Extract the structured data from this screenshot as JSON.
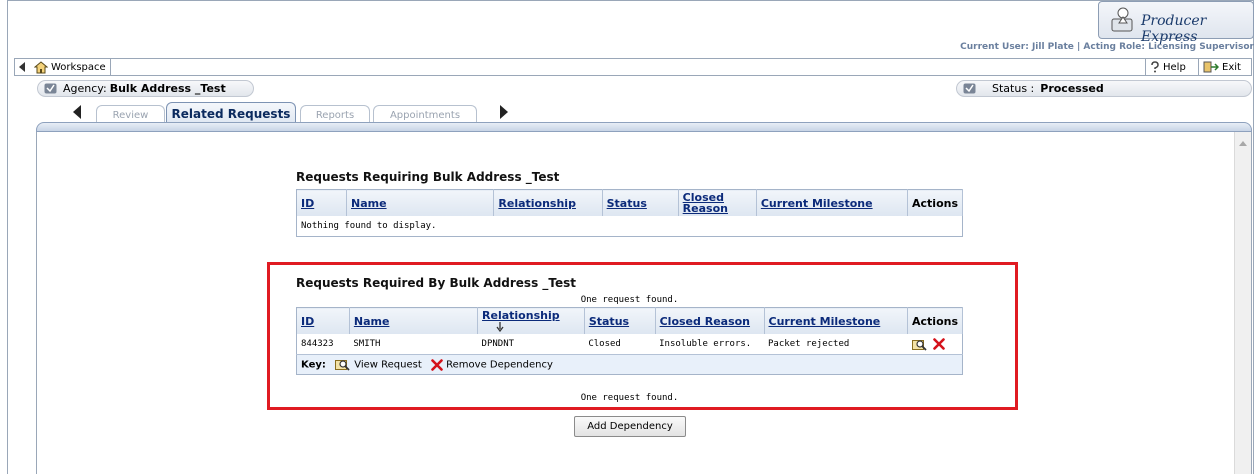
{
  "brand": {
    "name": "Producer Express"
  },
  "header": {
    "current_user_line": "Current User: Jill Plate | Acting Role: Licensing Supervisor"
  },
  "toolbar": {
    "workspace_label": "Workspace",
    "help_label": "Help",
    "exit_label": "Exit"
  },
  "agency": {
    "label": "Agency:",
    "name": "Bulk Address _Test"
  },
  "status": {
    "label": "Status :",
    "value": "Processed"
  },
  "tabs": [
    {
      "label": "Review",
      "active": false
    },
    {
      "label": "Related Requests",
      "active": true
    },
    {
      "label": "Reports",
      "active": false
    },
    {
      "label": "Appointments",
      "active": false
    }
  ],
  "requiring": {
    "title": "Requests Requiring Bulk Address _Test",
    "columns": [
      "ID",
      "Name",
      "Relationship",
      "Status",
      "Closed Reason",
      "Current Milestone",
      "Actions"
    ],
    "empty_message": "Nothing found to display."
  },
  "required_by": {
    "title": "Requests Required By Bulk Address _Test",
    "count_message": "One request found.",
    "columns": [
      "ID",
      "Name",
      "Relationship",
      "Status",
      "Closed Reason",
      "Current Milestone",
      "Actions"
    ],
    "rows": [
      {
        "id": "844323",
        "name": "SMITH",
        "relationship": "DPNDNT",
        "status": "Closed",
        "closed_reason": "Insoluble errors.",
        "current_milestone": "Packet rejected"
      }
    ],
    "key_label": "Key:",
    "key_view": "View Request",
    "key_remove": "Remove Dependency"
  },
  "add_dependency_label": "Add Dependency",
  "colors": {
    "highlight_border": "#e01b22",
    "header_link": "#0b2a7a",
    "remove_icon": "#d4121b"
  },
  "icons": [
    "home-icon",
    "help-icon",
    "exit-icon",
    "agency-icon",
    "status-icon",
    "view-request-icon",
    "remove-dependency-icon",
    "sort-arrow-icon",
    "producer-express-logo"
  ]
}
